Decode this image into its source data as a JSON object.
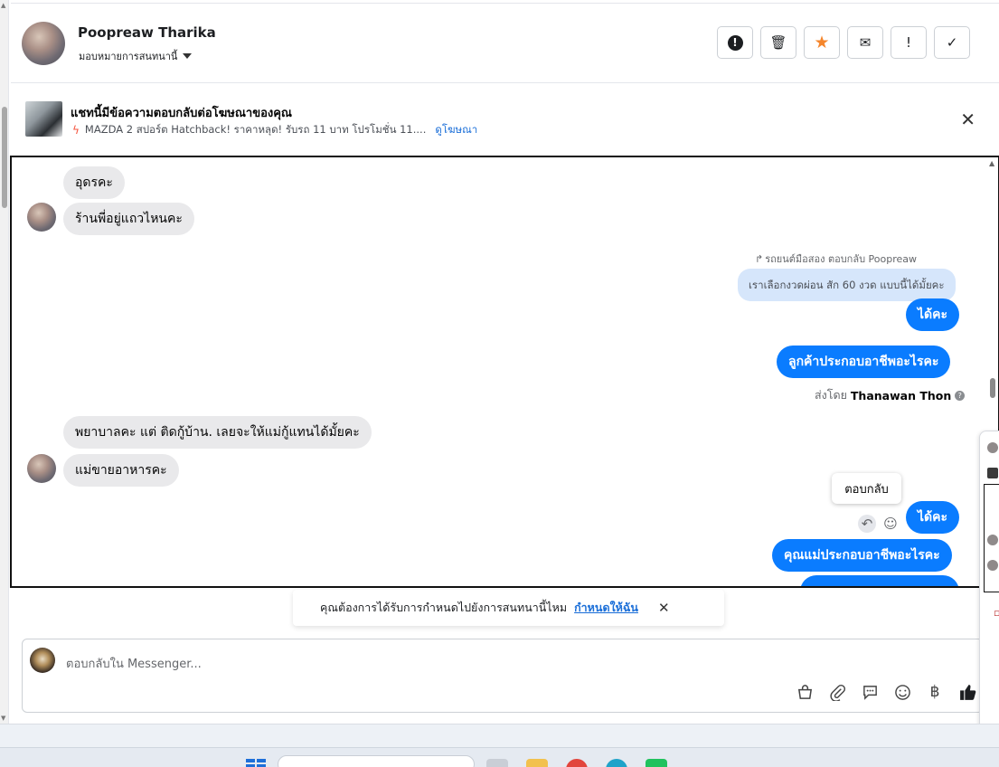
{
  "header": {
    "contact_name": "Poopreaw Tharika",
    "assign_label": "มอบหมายการสนทนานี้",
    "actions": [
      {
        "name": "report-icon",
        "glyph": "!"
      },
      {
        "name": "trash-icon",
        "glyph": "🗑"
      },
      {
        "name": "star-icon",
        "glyph": "★"
      },
      {
        "name": "mail-icon",
        "glyph": "✉"
      },
      {
        "name": "exclamation-icon",
        "glyph": "!"
      },
      {
        "name": "check-icon",
        "glyph": "✓"
      }
    ]
  },
  "ad_banner": {
    "title": "แชทนี้มีข้อความตอบกลับต่อโฆษณาของคุณ",
    "subtitle": "MAZDA 2 สปอร์ต Hatchback! ราคาหลุด! รับรถ 11 บาท โปรโมชั่น 11....",
    "link": "ดูโฆษณา",
    "close_glyph": "✕"
  },
  "messages": {
    "in_1": "อุดรคะ",
    "in_2": "ร้านพี่อยู่แถวไหนคะ",
    "reply_meta": "รถยนต์มือสอง ตอบกลับ Poopreaw",
    "quoted": "เราเลือกงวดผ่อน สัก 60 งวด แบบนี้ได้มั้ยคะ",
    "out_1": "ได้คะ",
    "out_2": "ลูกค้าประกอบอาชีพอะไรคะ",
    "sent_by_prefix": "ส่งโดย",
    "sent_by_name": "Thanawan Thon",
    "in_3": "พยาบาลคะ แต่ ติดกู้บ้าน. เลยจะให้แม่กู้แทนได้มั้ยคะ",
    "in_4": "แม่ขายอาหารคะ",
    "tooltip": "ตอบกลับ",
    "out_3": "ได้คะ",
    "out_4": "คุณแม่ประกอบอาชีพอะไรคะ"
  },
  "toast": {
    "text": "คุณต้องการได้รับการกำหนดไปยังการสนทนานี้ไหม",
    "link": "กำหนดให้ฉัน",
    "close_glyph": "✕"
  },
  "composer": {
    "placeholder": "ตอบกลับใน Messenger..."
  },
  "colors": {
    "outgoing": "#0a7cff",
    "incoming": "#e9e9eb",
    "quote": "#d6e6fb",
    "star": "#f5862c",
    "link": "#1a6ed8"
  }
}
